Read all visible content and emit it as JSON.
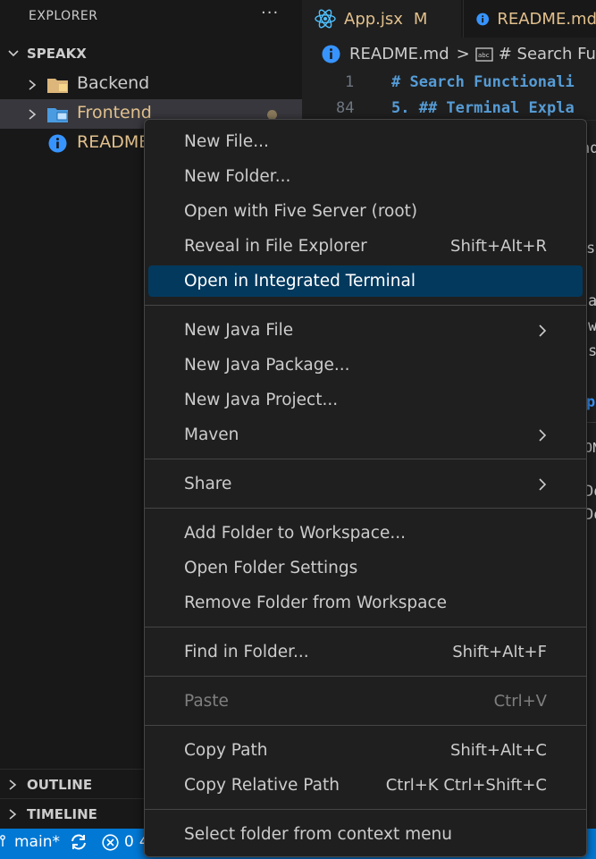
{
  "sidebar": {
    "title": "EXPLORER",
    "more": "···",
    "workspace": "SPEAKX",
    "items": [
      {
        "label": "Backend",
        "color": "#cccccc"
      },
      {
        "label": "Frontend",
        "color": "#e2c08d"
      },
      {
        "label": "README",
        "color": "#e2c08d"
      }
    ],
    "outline": "OUTLINE",
    "timeline": "TIMELINE"
  },
  "tabs": [
    {
      "label": "App.jsx",
      "badge": "M"
    },
    {
      "label": "README.md"
    }
  ],
  "breadcrumb": {
    "file": "README.md",
    "sep": ">",
    "symbol": "# Search Func"
  },
  "editor": {
    "lines": [
      {
        "num": "1",
        "text": "# Search Functionali"
      },
      {
        "num": "84",
        "text": "5. ## Terminal Expla"
      }
    ],
    "fragments": [
      "nd",
      "s.",
      "a",
      "w",
      "s",
      "pp",
      "ON",
      "Do",
      "Do"
    ]
  },
  "status": {
    "branch": "main*",
    "errors": "0",
    "trunc": "4"
  },
  "menu": {
    "groups": [
      [
        {
          "label": "New File..."
        },
        {
          "label": "New Folder..."
        },
        {
          "label": "Open with Five Server (root)"
        },
        {
          "label": "Reveal in File Explorer",
          "kb": "Shift+Alt+R"
        },
        {
          "label": "Open in Integrated Terminal",
          "highlighted": true
        }
      ],
      [
        {
          "label": "New Java File",
          "submenu": true
        },
        {
          "label": "New Java Package..."
        },
        {
          "label": "New Java Project..."
        },
        {
          "label": "Maven",
          "submenu": true
        }
      ],
      [
        {
          "label": "Share",
          "submenu": true
        }
      ],
      [
        {
          "label": "Add Folder to Workspace..."
        },
        {
          "label": "Open Folder Settings"
        },
        {
          "label": "Remove Folder from Workspace"
        }
      ],
      [
        {
          "label": "Find in Folder...",
          "kb": "Shift+Alt+F"
        }
      ],
      [
        {
          "label": "Paste",
          "kb": "Ctrl+V",
          "disabled": true
        }
      ],
      [
        {
          "label": "Copy Path",
          "kb": "Shift+Alt+C"
        },
        {
          "label": "Copy Relative Path",
          "kb": "Ctrl+K Ctrl+Shift+C"
        }
      ],
      [
        {
          "label": "Select folder from context menu"
        }
      ]
    ]
  },
  "colors": {
    "accent": "#0078d4",
    "highlight": "#04395e",
    "modified": "#e2c08d",
    "info": "#3794ff",
    "react": "#4fc1ff",
    "folder": "#dcb67a"
  }
}
